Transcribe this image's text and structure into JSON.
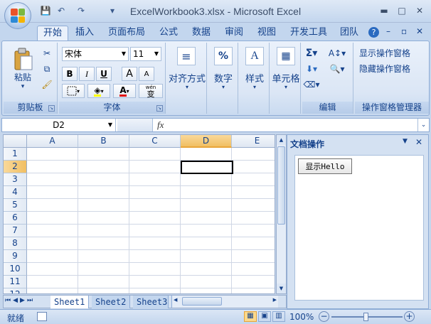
{
  "window": {
    "title": "ExcelWorkbook3.xlsx - Microsoft Excel",
    "minimize": "▬",
    "maximize": "□",
    "close": "✕",
    "ribbon_min": "–",
    "ribbon_restore": "▫",
    "ribbon_close": "✕"
  },
  "qat": {
    "save": "💾",
    "undo": "↶",
    "redo": "↷",
    "customize": "▾"
  },
  "tabs": [
    "开始",
    "插入",
    "页面布局",
    "公式",
    "数据",
    "审阅",
    "视图",
    "开发工具",
    "团队"
  ],
  "help_icon": "?",
  "ribbon": {
    "clipboard": {
      "label": "剪贴板",
      "paste": "粘贴",
      "paste_arrow": "▾"
    },
    "font": {
      "label": "字体",
      "font_name": "宋体",
      "font_size": "11",
      "bold": "B",
      "italic": "I",
      "underline": "U",
      "grow": "A",
      "shrink": "A",
      "wen": "wén",
      "wen_char": "变"
    },
    "alignment": {
      "label": "对齐方式"
    },
    "number": {
      "label": "数字"
    },
    "styles": {
      "label": "样式"
    },
    "cells": {
      "label": "单元格"
    },
    "editing": {
      "label": "编辑"
    },
    "taskpane_mgr": {
      "label": "操作窗格管理器",
      "show": "显示操作窗格",
      "hide": "隐藏操作窗格"
    }
  },
  "formula_bar": {
    "name_box": "D2",
    "fx": "fx",
    "value": ""
  },
  "grid": {
    "columns": [
      "A",
      "B",
      "C",
      "D",
      "E"
    ],
    "selected_column": "D",
    "rows": [
      "1",
      "2",
      "3",
      "4",
      "5",
      "6",
      "7",
      "8",
      "9",
      "10",
      "11",
      "12"
    ],
    "selected_row": "2",
    "active_cell": "D2"
  },
  "sheets": [
    "Sheet1",
    "Sheet2",
    "Sheet3"
  ],
  "active_sheet": "Sheet1",
  "task_pane": {
    "title": "文档操作",
    "button": "显示Hello"
  },
  "status": {
    "ready": "就绪",
    "zoom": "100%"
  },
  "colors": {
    "accent": "#15428b",
    "ribbon": "#dbe6f5",
    "selected_header": "#f1bf62"
  }
}
